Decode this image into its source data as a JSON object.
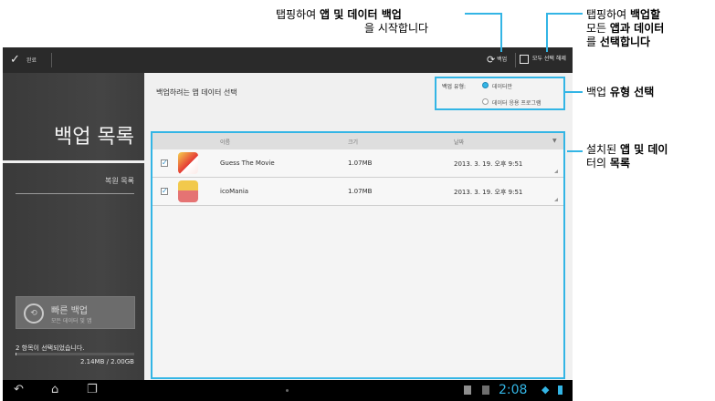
{
  "topbar": {
    "done_label": "완료",
    "backup_label": "백업",
    "select_all_label": "모두 선택 해제"
  },
  "sidebar": {
    "title": "백업 목록",
    "restore_link": "복원 목록",
    "quick_backup": {
      "title": "빠른 백업",
      "subtitle": "모든 데이터 및 앱"
    },
    "selected_count": "2 항목이 선택되었습니다.",
    "size_info": "2.14MB / 2.00GB",
    "progress_fraction": 0.01
  },
  "main": {
    "title": "백업하려는 앱 데이터 선택",
    "backup_type_label": "백업 유형:",
    "options": [
      "데이터만",
      "데이터 응용 프로그램"
    ],
    "selected_option": "데이터만",
    "columns": [
      "이름",
      "크기",
      "날짜"
    ],
    "rows": [
      {
        "name": "Guess The Movie",
        "size": "1.07MB",
        "date": "2013. 3. 19. 오후 9:51",
        "checked": true,
        "icon": "guess-the-movie-icon"
      },
      {
        "name": "icoMania",
        "size": "1.07MB",
        "date": "2013. 3. 19. 오후 9:51",
        "checked": true,
        "icon": "icomania-icon"
      }
    ]
  },
  "statusbar": {
    "time": "2:08"
  },
  "callouts": {
    "backup_start": {
      "l1_a": "탭핑하여 ",
      "l1_b": "앱 및 데이터 백업",
      "l2_a": "을 시작합니다"
    },
    "select_all": {
      "l1_a": "탭핑하여 ",
      "l1_b": "백업할",
      "l2_a": "모든 ",
      "l2_b": "앱과 데이터",
      "l3_a": "를 ",
      "l3_b": "선택합니다"
    },
    "backup_type": {
      "a": "백업 ",
      "b": "유형 선택"
    },
    "installed": {
      "l1_a": "설치된 ",
      "l1_b": "앱 및 데이",
      "l2_a": "터의 ",
      "l2_b": "목록"
    }
  },
  "colors": {
    "accent": "#33b5e5",
    "sidebar": "#404040",
    "content": "#f0f0f0"
  }
}
